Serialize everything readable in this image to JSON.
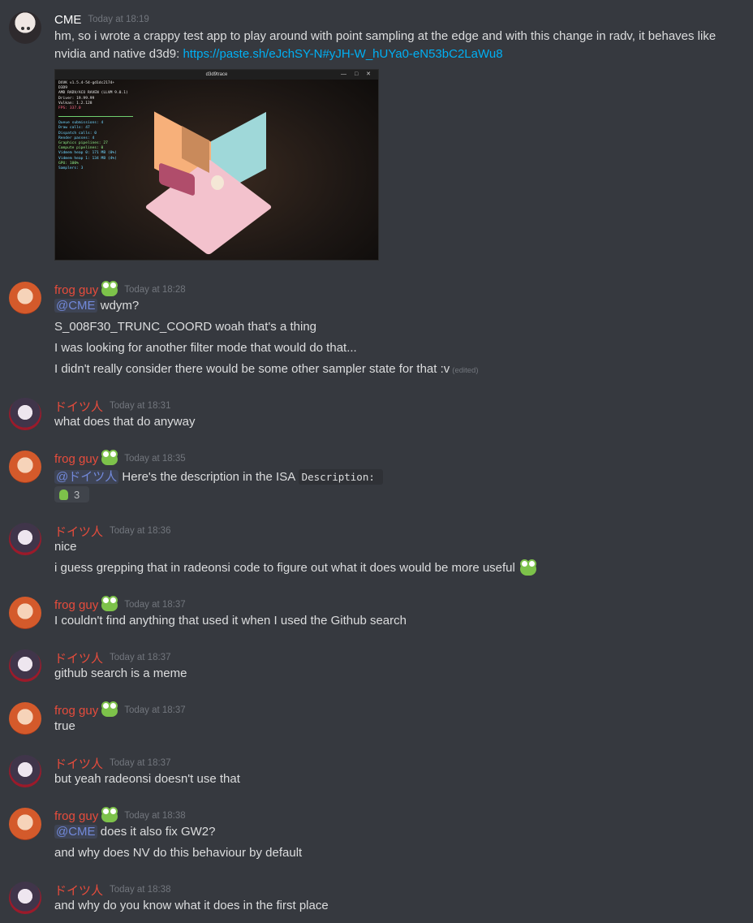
{
  "messages": [
    {
      "author": "CME",
      "timestamp": "Today at 18:19",
      "lines": [
        "hm, so i wrote a crappy test app to play around with point sampling at the edge and with this change in radv, it behaves like",
        "nvidia and native d3d9: "
      ],
      "link": "https://paste.sh/eJchSY-N#yJH-W_hUYa0-eN53bC2LaWu8",
      "attachment": {
        "title": "d3d9trace",
        "hud": [
          "DXVK v1.5.4-54-gd1dc2174+",
          "D3D9",
          "AMD RADV/ACO RAVEN (LLVM 9.0.1)",
          "Driver: 19.99.99",
          "Vulkan: 1.2.128",
          "FPS: 337.0"
        ],
        "stats": [
          "Queue submissions: 4",
          "Draw calls:    47",
          "Dispatch calls: 0",
          "Render passes: 4",
          "Graphics pipelines: 27",
          "Compute pipelines: 0",
          "Vidmem heap 0:  171 MB (0%)",
          "Vidmem heap 1:  134 MB (4%)",
          "GPU: 100%",
          "Samplers: 3"
        ]
      }
    },
    {
      "author": "frog guy",
      "timestamp": "Today at 18:28",
      "mention": "@CME",
      "lines": [
        " wdym?",
        "S_008F30_TRUNC_COORD woah that's a thing",
        "I was looking for another filter mode that would do that...",
        "I didn't really consider there would be some other sampler state for that :v"
      ],
      "edited": "(edited)"
    },
    {
      "author": "ドイツ人",
      "timestamp": "Today at 18:31",
      "lines": [
        "what does that do anyway"
      ]
    },
    {
      "author": "frog guy",
      "timestamp": "Today at 18:35",
      "mention": "@ドイツ人",
      "lines": [
        " Here's the description in the ISA "
      ],
      "code": "Description:",
      "reaction_count": "3"
    },
    {
      "author": "ドイツ人",
      "timestamp": "Today at 18:36",
      "lines": [
        "nice",
        "i guess grepping that in radeonsi code to figure out what it does would be more useful"
      ]
    },
    {
      "author": "frog guy",
      "timestamp": "Today at 18:37",
      "lines": [
        "I couldn't find anything that used it when I used the Github search"
      ]
    },
    {
      "author": "ドイツ人",
      "timestamp": "Today at 18:37",
      "lines": [
        "github search is a meme"
      ]
    },
    {
      "author": "frog guy",
      "timestamp": "Today at 18:37",
      "lines": [
        "true"
      ]
    },
    {
      "author": "ドイツ人",
      "timestamp": "Today at 18:37",
      "lines": [
        "but yeah radeonsi doesn't use that"
      ]
    },
    {
      "author": "frog guy",
      "timestamp": "Today at 18:38",
      "mention": "@CME",
      "lines": [
        " does it also fix GW2?",
        "and why does NV do this behaviour by default"
      ]
    },
    {
      "author": "ドイツ人",
      "timestamp": "Today at 18:38",
      "lines": [
        "and why do you know what it does in the first place"
      ]
    }
  ],
  "colors": {
    "background": "#36393f",
    "text": "#dcddde",
    "timestamp": "#72767d",
    "link": "#00b0f4",
    "mention": "#7289da",
    "role_red": "#e74c3c"
  }
}
